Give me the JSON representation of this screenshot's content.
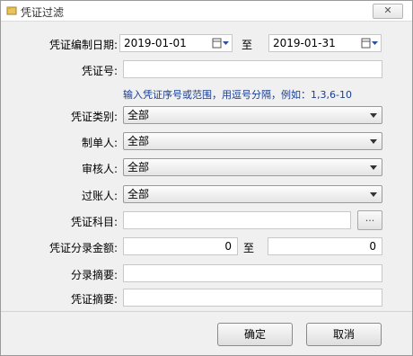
{
  "window": {
    "title": "凭证过滤",
    "close_label": "✕"
  },
  "date_range": {
    "label": "凭证编制日期:",
    "from": "2019-01-01",
    "to_label": "至",
    "to": "2019-01-31"
  },
  "voucher_no": {
    "label": "凭证号:",
    "value": "",
    "hint": "输入凭证序号或范围，用逗号分隔，例如：1,3,6-10"
  },
  "voucher_type": {
    "label": "凭证类别:",
    "value": "全部"
  },
  "preparer": {
    "label": "制单人:",
    "value": "全部"
  },
  "reviewer": {
    "label": "审核人:",
    "value": "全部"
  },
  "poster": {
    "label": "过账人:",
    "value": "全部"
  },
  "subject": {
    "label": "凭证科目:",
    "value": "",
    "browse_label": "..."
  },
  "amount_range": {
    "label": "凭证分录金额:",
    "from": "0",
    "to_label": "至",
    "to": "0"
  },
  "entry_summary": {
    "label": "分录摘要:",
    "value": ""
  },
  "voucher_summary": {
    "label": "凭证摘要:",
    "value": ""
  },
  "footer": {
    "ok_label": "确定",
    "cancel_label": "取消"
  },
  "colors": {
    "hint_text": "#1a3d8f",
    "window_bg": "#f0f0f0"
  }
}
